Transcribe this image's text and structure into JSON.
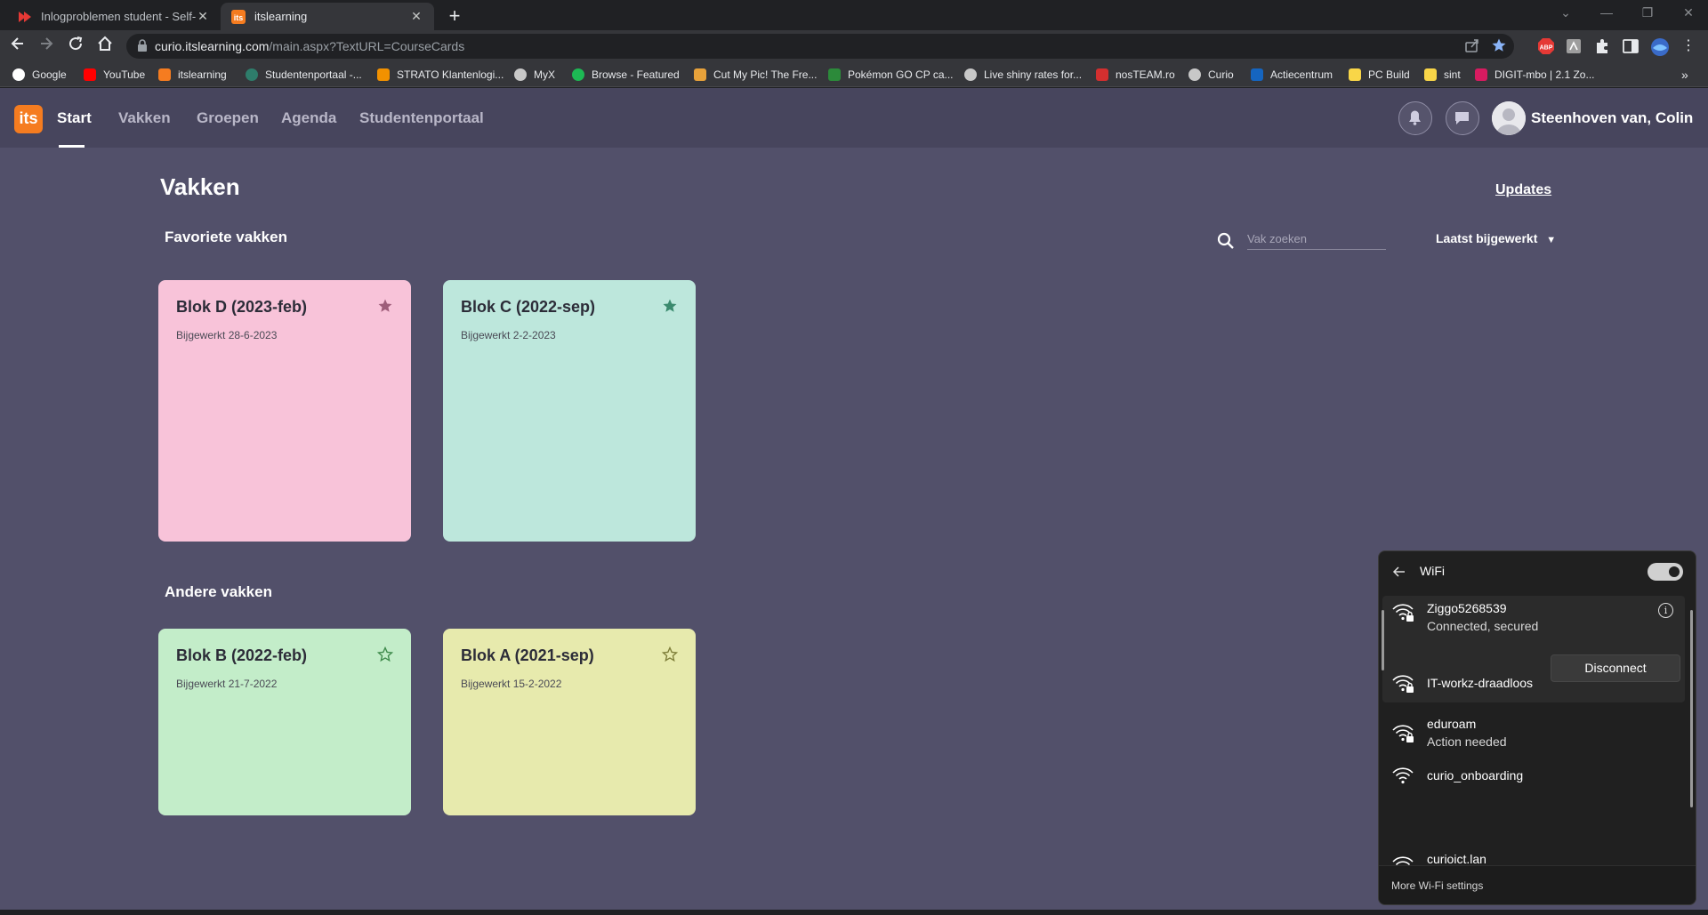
{
  "browser": {
    "tabs": [
      {
        "title": "Inlogproblemen student - Self-Se",
        "active": false
      },
      {
        "title": "itslearning",
        "active": true
      }
    ],
    "new_tab": "+",
    "url_host": "curio.itslearning.com",
    "url_path": "/main.aspx?TextURL=CourseCards",
    "extension_abp": "ABP",
    "bookmarks": [
      {
        "label": "Google",
        "color": "#4285f4"
      },
      {
        "label": "YouTube",
        "color": "#ff0000"
      },
      {
        "label": "itslearning",
        "color": "#f57c20"
      },
      {
        "label": "Studentenportaal -...",
        "color": "#2e7d6b"
      },
      {
        "label": "STRATO Klantenlogi...",
        "color": "#f29100"
      },
      {
        "label": "MyX",
        "color": "#c8c8c8"
      },
      {
        "label": "Browse - Featured",
        "color": "#1db954"
      },
      {
        "label": "Cut My Pic! The Fre...",
        "color": "#e8a23a"
      },
      {
        "label": "Pokémon GO CP ca...",
        "color": "#2c8a3a"
      },
      {
        "label": "Live shiny rates for...",
        "color": "#c8c8c8"
      },
      {
        "label": "nosTEAM.ro",
        "color": "#d32f2f"
      },
      {
        "label": "Curio",
        "color": "#c8c8c8"
      },
      {
        "label": "Actiecentrum",
        "color": "#1565c0"
      },
      {
        "label": "PC Build",
        "color": "#f9d648"
      },
      {
        "label": "sint",
        "color": "#f9d648"
      },
      {
        "label": "DIGIT-mbo | 2.1 Zo...",
        "color": "#d81b60"
      }
    ],
    "bookmarks_more": "»"
  },
  "site": {
    "logo": "its",
    "nav": [
      "Start",
      "Vakken",
      "Groepen",
      "Agenda",
      "Studentenportaal"
    ],
    "user_name": "Steenhoven van, Colin"
  },
  "main": {
    "title": "Vakken",
    "updates_link": "Updates",
    "favorites_heading": "Favoriete vakken",
    "others_heading": "Andere vakken",
    "search_placeholder": "Vak zoeken",
    "sort_label": "Laatst bijgewerkt",
    "favorite_courses": [
      {
        "title": "Blok D (2023-feb)",
        "updated": "Bijgewerkt 28-6-2023",
        "color": "#f8c3d9",
        "star_color": "#9e5d7a",
        "favorite": true
      },
      {
        "title": "Blok C (2022-sep)",
        "updated": "Bijgewerkt 2-2-2023",
        "color": "#bde7dc",
        "star_color": "#3b8a6e",
        "favorite": true
      }
    ],
    "other_courses": [
      {
        "title": "Blok B (2022-feb)",
        "updated": "Bijgewerkt 21-7-2022",
        "color": "#c3edc9",
        "star_color": "#3e8a4b",
        "favorite": false
      },
      {
        "title": "Blok A (2021-sep)",
        "updated": "Bijgewerkt 15-2-2022",
        "color": "#e7eaad",
        "star_color": "#7d7d38",
        "favorite": false
      }
    ]
  },
  "wifi_panel": {
    "title": "WiFi",
    "toggle_on": true,
    "connected": {
      "name": "Ziggo5268539",
      "status": "Connected, secured",
      "info_glyph": "i"
    },
    "disconnect_label": "Disconnect",
    "networks": [
      {
        "name": "IT-workz-draadloos",
        "status": "",
        "secured": true
      },
      {
        "name": "eduroam",
        "status": "Action needed",
        "secured": true
      },
      {
        "name": "curio_onboarding",
        "status": "",
        "secured": false
      },
      {
        "name": "curioict.lan",
        "status": "",
        "secured": false
      }
    ],
    "more_settings": "More Wi-Fi settings"
  }
}
